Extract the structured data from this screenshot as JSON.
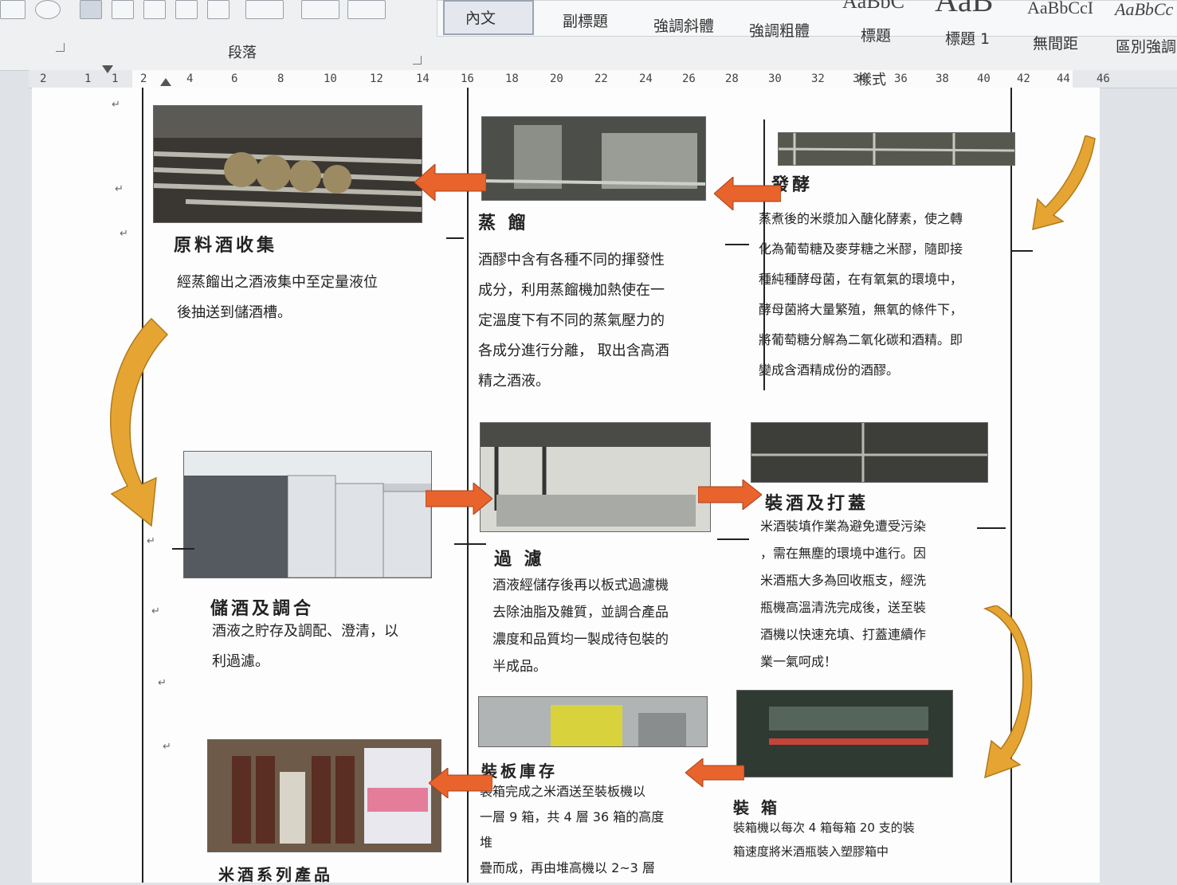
{
  "ribbon": {
    "paragraph_group": "段落",
    "styles_group": "樣式",
    "styles": [
      "內文",
      "副標題",
      "強調斜體",
      "強調粗體",
      "標題",
      "標題 1",
      "無間距",
      "區別強調"
    ],
    "style_samples": [
      "AaBbC",
      "AaB",
      "AaBbCcI",
      "AaBbCc"
    ]
  },
  "ruler": {
    "ticks": [
      "2",
      "1",
      "1",
      "2",
      "4",
      "6",
      "8",
      "10",
      "12",
      "14",
      "16",
      "18",
      "20",
      "22",
      "24",
      "26",
      "28",
      "30",
      "32",
      "34",
      "36",
      "38",
      "40",
      "42",
      "44",
      "46"
    ]
  },
  "document": {
    "steps": {
      "collect": {
        "title": "原料酒收集",
        "lines": [
          "經蒸餾出之酒液集中至定量液位",
          "後抽送到儲酒槽。"
        ]
      },
      "distill": {
        "title": "蒸 餾",
        "lines": [
          "酒醪中含有各種不同的揮發性",
          "成分，利用蒸餾機加熱使在一",
          "定溫度下有不同的蒸氣壓力的",
          "各成分進行分離， 取出含高酒",
          "精之酒液。"
        ]
      },
      "ferment": {
        "title": "發酵",
        "lines": [
          "蒸煮後的米漿加入醣化酵素，使之轉",
          "化為葡萄糖及麥芽糖之米醪，隨即接",
          "種純種酵母菌，在有氧氣的環境中，",
          "酵母菌將大量繁殖，無氧的條件下，",
          "將葡萄糖分解為二氧化碳和酒精。即",
          "變成含酒精成份的酒醪。"
        ]
      },
      "store": {
        "title": "儲酒及調合",
        "lines": [
          "酒液之貯存及調配、澄清，以",
          "利過濾。"
        ]
      },
      "filter": {
        "title": "過 濾",
        "lines": [
          "酒液經儲存後再以板式過濾機",
          "去除油脂及雜質，並調合產品",
          "濃度和品質均一製成待包裝的",
          "半成品。"
        ]
      },
      "bottle": {
        "title": "裝酒及打蓋",
        "lines": [
          "米酒裝填作業為避免遭受污染",
          "，需在無塵的環境中進行。因",
          "米酒瓶大多為回收瓶支，經洗",
          "瓶機高溫清洗完成後，送至裝",
          "酒機以快速充填、打蓋連續作",
          "業一氣呵成！"
        ]
      },
      "pallet": {
        "title": "裝板庫存",
        "lines": [
          "裝箱完成之米酒送至裝板機以",
          "一層 9 箱，共 4 層 36 箱的高度",
          "堆",
          "疊而成，再由堆高機以 2~3 層"
        ]
      },
      "box": {
        "title": "裝 箱",
        "lines": [
          "裝箱機以每次 4 箱每箱 20 支的裝",
          "箱速度將米酒瓶裝入塑膠箱中"
        ]
      },
      "products": {
        "title": "米酒系列產品"
      }
    }
  },
  "colors": {
    "arrow_orange": "#e8642c",
    "curve_gold": "#e6a533",
    "ribbon_bg": "#eef0f2",
    "page_bg": "#fdfdfd"
  }
}
